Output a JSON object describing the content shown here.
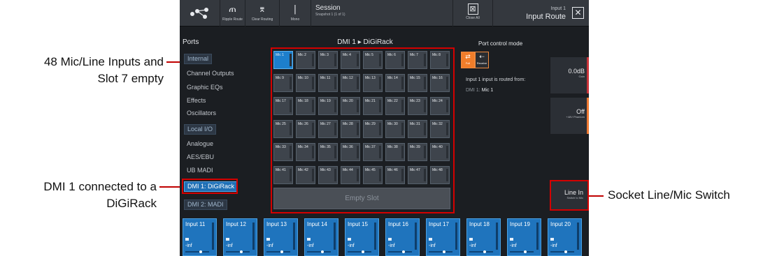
{
  "annotations": {
    "mic_inputs_line1": "48 Mic/Line Inputs and",
    "mic_inputs_line2": "Slot 7 empty",
    "dmi_line1": "DMI 1 connected to a",
    "dmi_line2": "DiGiRack",
    "socket_switch": "Socket Line/Mic Switch",
    "line_color": "#c00000"
  },
  "toolbar": {
    "ripple_route": "Ripple Route",
    "clear_routing": "Clear Routing",
    "mono": "Mono",
    "session_title": "Session",
    "session_snapshot": "Snapshot 1 (1 of 1)",
    "session_status": "",
    "close_all": "Close All",
    "input_name": "Input 1",
    "panel_title": "Input Route"
  },
  "ports": {
    "title": "Ports",
    "internal_header": "Internal",
    "internal_items": [
      "Channel Outputs",
      "Graphic EQs",
      "Effects",
      "Oscillators"
    ],
    "local_header": "Local I/O",
    "local_items": [
      "Analogue",
      "AES/EBU",
      "UB MADI"
    ],
    "dmi1": "DMI 1: DiGiRack",
    "dmi2": "DMI 2: MADI"
  },
  "grid": {
    "title": "DMI 1 ▸ DiGiRack",
    "mics": [
      "Mic 1",
      "Mic 2",
      "Mic 3",
      "Mic 4",
      "Mic 5",
      "Mic 6",
      "Mic 7",
      "Mic 8",
      "Mic 9",
      "Mic 10",
      "Mic 11",
      "Mic 12",
      "Mic 13",
      "Mic 14",
      "Mic 15",
      "Mic 16",
      "Mic 17",
      "Mic 18",
      "Mic 19",
      "Mic 20",
      "Mic 21",
      "Mic 22",
      "Mic 23",
      "Mic 24",
      "Mic 25",
      "Mic 26",
      "Mic 27",
      "Mic 28",
      "Mic 29",
      "Mic 30",
      "Mic 31",
      "Mic 32",
      "Mic 33",
      "Mic 34",
      "Mic 35",
      "Mic 36",
      "Mic 37",
      "Mic 38",
      "Mic 39",
      "Mic 40",
      "Mic 41",
      "Mic 42",
      "Mic 43",
      "Mic 44",
      "Mic 45",
      "Mic 46",
      "Mic 47",
      "Mic 48"
    ],
    "selected": "Mic 1",
    "empty_slot": "Empty Slot"
  },
  "port_control": {
    "title": "Port control mode",
    "full": "Full",
    "receive": "Receive",
    "routed_from": "Input 1 input is routed from:",
    "source_port": "DMI 1:",
    "source_mic": "Mic 1"
  },
  "params": {
    "gain_value": "0.0dB",
    "gain_label": "Gain",
    "phantom_value": "Off",
    "phantom_label": "+48V Phantom",
    "line_value": "Line In",
    "line_label": "Switch to Mic"
  },
  "strips": [
    {
      "name": "Input 11",
      "level": "-inf"
    },
    {
      "name": "Input 12",
      "level": "-inf"
    },
    {
      "name": "Input 13",
      "level": "-inf"
    },
    {
      "name": "Input 14",
      "level": "-inf"
    },
    {
      "name": "Input 15",
      "level": "-inf"
    },
    {
      "name": "Input 16",
      "level": "-inf"
    },
    {
      "name": "Input 17",
      "level": "-inf"
    },
    {
      "name": "Input 18",
      "level": "-inf"
    },
    {
      "name": "Input 19",
      "level": "-inf"
    },
    {
      "name": "Input 20",
      "level": "-inf"
    }
  ],
  "colors": {
    "accent": "#1f74bd",
    "orange": "#f07d2a",
    "highlight_box": "#d40000"
  }
}
